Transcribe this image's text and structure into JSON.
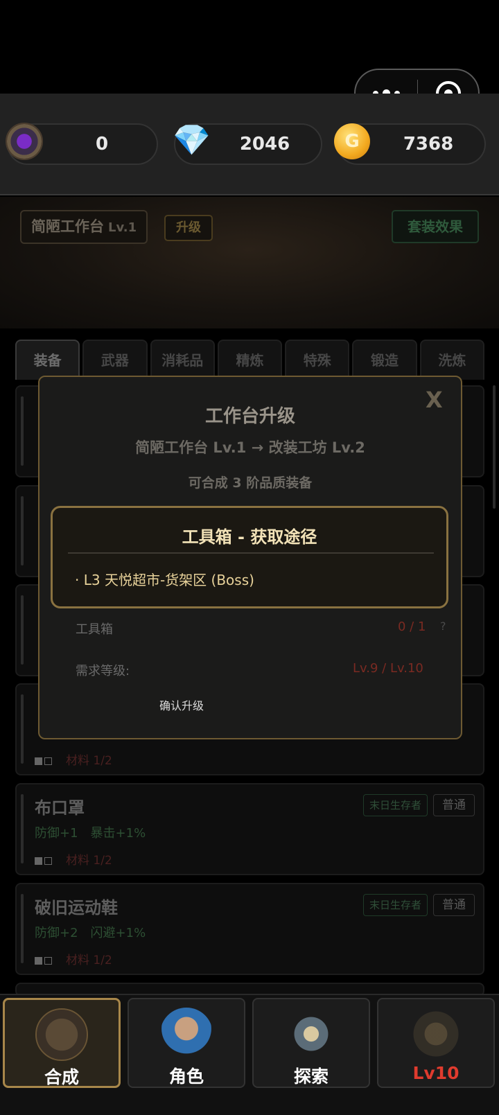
{
  "capsule": {
    "more_icon": "more-dots-icon",
    "target_icon": "target-icon"
  },
  "currency": {
    "orb_value": "0",
    "gem_value": "2046",
    "gold_value": "7368",
    "gold_symbol": "G",
    "gem_symbol": "💎"
  },
  "workshop": {
    "name": "简陋工作台",
    "level": "Lv.1",
    "upgrade_label": "升级",
    "set_effect_label": "套装效果"
  },
  "tabs": [
    "装备",
    "武器",
    "消耗品",
    "精炼",
    "特殊",
    "锻造",
    "洗炼"
  ],
  "items": [
    {
      "name": "布口罩",
      "stats": [
        "防御+1",
        "暴击+1%"
      ],
      "materials": "材料 1/2",
      "tag": "末日生存者",
      "grade": "普通"
    },
    {
      "name": "破旧运动鞋",
      "stats": [
        "防御+2",
        "闪避+1%"
      ],
      "materials": "材料 1/2",
      "tag": "末日生存者",
      "grade": "普通"
    }
  ],
  "hidden_card_material": "材料 1/2",
  "modal": {
    "close": "X",
    "title": "工作台升级",
    "subtitle": "简陋工作台 Lv.1  →  改装工坊 Lv.2",
    "quality": "可合成 3 阶品质装备",
    "req_item_label": "工具箱",
    "req_item_value": "0 / 1",
    "req_help": "?",
    "req_level_label": "需求等级:",
    "req_level_value": "Lv.9 / Lv.10",
    "confirm_label": "确认升级"
  },
  "popup": {
    "title": "工具箱 - 获取途径",
    "source": "· L3 天悦超市-货架区 (Boss)"
  },
  "nav": [
    {
      "label": "合成",
      "icon": "crafting-tools-icon",
      "active": true
    },
    {
      "label": "角色",
      "icon": "character-portrait-icon",
      "active": false
    },
    {
      "label": "探索",
      "icon": "compass-swords-icon",
      "active": false
    },
    {
      "label": "Lv10",
      "icon": "locked-shop-icon",
      "active": false,
      "locked": true
    }
  ],
  "colors": {
    "accent_gold": "#a8874a",
    "locked_red": "#e03b2e",
    "popup_text": "#f3e3b8"
  }
}
